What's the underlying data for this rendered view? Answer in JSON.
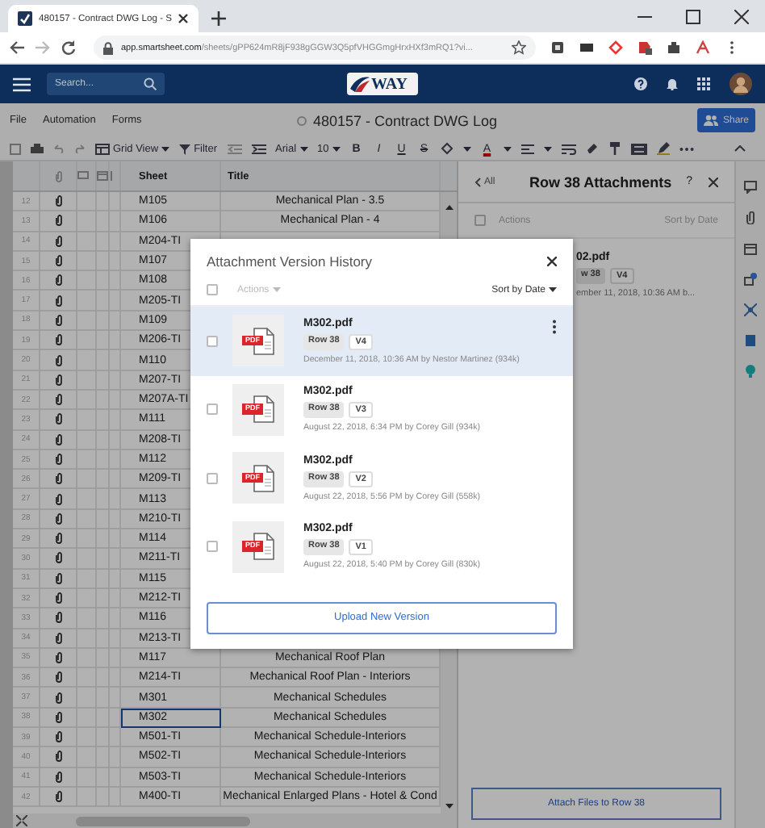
{
  "browser": {
    "tab_title": "480157 - Contract DWG Log - S",
    "url_domain": "app.smartsheet.com",
    "url_path": "/sheets/gPP624mR8jF938gGGW3Q5pfVHGGmgHrxHXf3mRQ1?vi..."
  },
  "app_header": {
    "search_placeholder": "Search...",
    "logo_text": "WAY"
  },
  "menu": [
    "File",
    "Automation",
    "Forms"
  ],
  "sheet_title": "480157 - Contract DWG Log",
  "share": "Share",
  "toolbar": {
    "view": "Grid View",
    "filter": "Filter",
    "font": "Arial",
    "size": "10",
    "format_buttons": [
      "B",
      "I",
      "U",
      "S"
    ],
    "text_color": "A"
  },
  "grid": {
    "columns": [
      "Sheet",
      "Title"
    ],
    "rows": [
      {
        "number": "12",
        "sheet": "M105",
        "title": "Mechanical Plan - 3.5",
        "selected": false
      },
      {
        "number": "13",
        "sheet": "M106",
        "title": "Mechanical Plan - 4",
        "selected": false
      },
      {
        "number": "14",
        "sheet": "M204-TI",
        "selected": false
      },
      {
        "number": "15",
        "sheet": "M107",
        "selected": false
      },
      {
        "number": "16",
        "sheet": "M108",
        "selected": false
      },
      {
        "number": "17",
        "sheet": "M205-TI",
        "selected": false
      },
      {
        "number": "18",
        "sheet": "M109",
        "selected": false
      },
      {
        "number": "19",
        "sheet": "M206-TI",
        "selected": false
      },
      {
        "number": "20",
        "sheet": "M110",
        "selected": false
      },
      {
        "number": "21",
        "sheet": "M207-TI",
        "selected": false
      },
      {
        "number": "22",
        "sheet": "M207A-TI",
        "selected": false
      },
      {
        "number": "23",
        "sheet": "M111",
        "selected": false
      },
      {
        "number": "24",
        "sheet": "M208-TI",
        "selected": false
      },
      {
        "number": "25",
        "sheet": "M112",
        "selected": false
      },
      {
        "number": "26",
        "sheet": "M209-TI",
        "selected": false
      },
      {
        "number": "27",
        "sheet": "M113",
        "selected": false
      },
      {
        "number": "28",
        "sheet": "M210-TI",
        "selected": false
      },
      {
        "number": "29",
        "sheet": "M114",
        "selected": false
      },
      {
        "number": "30",
        "sheet": "M211-TI",
        "selected": false
      },
      {
        "number": "31",
        "sheet": "M115",
        "selected": false
      },
      {
        "number": "32",
        "sheet": "M212-TI",
        "selected": false
      },
      {
        "number": "33",
        "sheet": "M116",
        "selected": false
      },
      {
        "number": "34",
        "sheet": "M213-TI",
        "selected": false
      },
      {
        "number": "35",
        "sheet": "M117",
        "title": "Mechanical Roof Plan",
        "selected": false
      },
      {
        "number": "36",
        "sheet": "M214-TI",
        "title": "Mechanical Roof Plan - Interiors",
        "selected": false
      },
      {
        "number": "37",
        "sheet": "M301",
        "title": "Mechanical Schedules",
        "selected": false
      },
      {
        "number": "38",
        "sheet": "M302",
        "title": "Mechanical Schedules",
        "selected": true
      },
      {
        "number": "39",
        "sheet": "M501-TI",
        "title": "Mechanical Schedule-Interiors",
        "selected": false
      },
      {
        "number": "40",
        "sheet": "M502-TI",
        "title": "Mechanical Schedule-Interiors",
        "selected": false
      },
      {
        "number": "41",
        "sheet": "M503-TI",
        "title": "Mechanical Schedule-Interiors",
        "selected": false
      },
      {
        "number": "42",
        "sheet": "M400-TI",
        "title": "Mechanical Enlarged Plans - Hotel & Cond",
        "selected": false
      }
    ]
  },
  "panel": {
    "back": "All",
    "title": "Row 38 Attachments",
    "help": "?",
    "select_all_checked": false,
    "actions": "Actions",
    "sort": "Sort by Date",
    "attachment": {
      "file": "02.pdf",
      "row": "w 38",
      "version": "V4",
      "meta": "ember 11, 2018, 10:36 AM b..."
    },
    "attach_button": "Attach Files to Row 38"
  },
  "modal": {
    "title": "Attachment Version History",
    "select_all_checked": false,
    "actions": "Actions",
    "sort": "Sort by Date",
    "versions": [
      {
        "badge": "PDF",
        "file": "M302.pdf",
        "row": "Row 38",
        "version": "V4",
        "meta": "December 11, 2018, 10:36 AM by Nestor Martinez (934k)",
        "selected": true,
        "checked": false
      },
      {
        "badge": "PDF",
        "file": "M302.pdf",
        "row": "Row 38",
        "version": "V3",
        "meta": "August 22, 2018, 6:34 PM by Corey Gill (934k)",
        "selected": false,
        "checked": false
      },
      {
        "badge": "PDF",
        "file": "M302.pdf",
        "row": "Row 38",
        "version": "V2",
        "meta": "August 22, 2018, 5:56 PM by Corey Gill (558k)",
        "selected": false,
        "checked": false
      },
      {
        "badge": "PDF",
        "file": "M302.pdf",
        "row": "Row 38",
        "version": "V1",
        "meta": "August 22, 2018, 5:40 PM by Corey Gill (830k)",
        "selected": false,
        "checked": false
      }
    ],
    "upload": "Upload New Version"
  }
}
